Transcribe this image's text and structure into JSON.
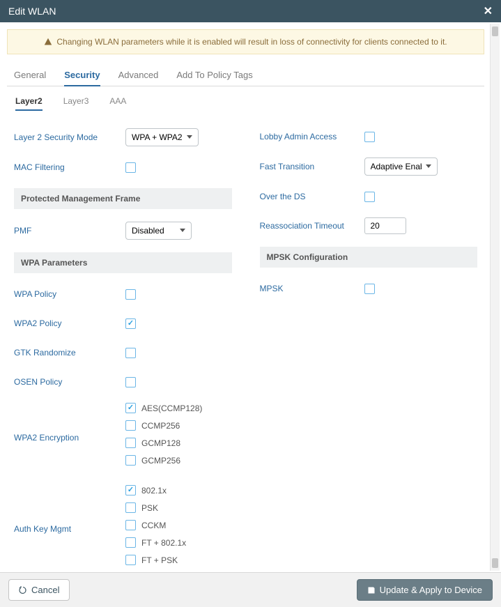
{
  "header": {
    "title": "Edit WLAN"
  },
  "alert": {
    "message": "Changing WLAN parameters while it is enabled will result in loss of connectivity for clients connected to it."
  },
  "tabs": {
    "items": [
      "General",
      "Security",
      "Advanced",
      "Add To Policy Tags"
    ],
    "active": 1
  },
  "subtabs": {
    "items": [
      "Layer2",
      "Layer3",
      "AAA"
    ],
    "active": 0
  },
  "left": {
    "l2mode": {
      "label": "Layer 2 Security Mode",
      "value": "WPA + WPA2"
    },
    "macfilter": {
      "label": "MAC Filtering",
      "checked": false
    },
    "pmf_section": "Protected Management Frame",
    "pmf": {
      "label": "PMF",
      "value": "Disabled"
    },
    "wpa_section": "WPA Parameters",
    "wpa_policy": {
      "label": "WPA Policy",
      "checked": false
    },
    "wpa2_policy": {
      "label": "WPA2 Policy",
      "checked": true
    },
    "gtk": {
      "label": "GTK Randomize",
      "checked": false
    },
    "osen": {
      "label": "OSEN Policy",
      "checked": false
    },
    "wpa2enc": {
      "label": "WPA2 Encryption",
      "options": [
        {
          "label": "AES(CCMP128)",
          "checked": true
        },
        {
          "label": "CCMP256",
          "checked": false
        },
        {
          "label": "GCMP128",
          "checked": false
        },
        {
          "label": "GCMP256",
          "checked": false
        }
      ]
    },
    "akm": {
      "label": "Auth Key Mgmt",
      "options": [
        {
          "label": "802.1x",
          "checked": true
        },
        {
          "label": "PSK",
          "checked": false
        },
        {
          "label": "CCKM",
          "checked": false
        },
        {
          "label": "FT + 802.1x",
          "checked": false
        },
        {
          "label": "FT + PSK",
          "checked": false
        }
      ]
    }
  },
  "right": {
    "lobby": {
      "label": "Lobby Admin Access",
      "checked": false
    },
    "ft": {
      "label": "Fast Transition",
      "value": "Adaptive Enab..."
    },
    "overds": {
      "label": "Over the DS",
      "checked": false
    },
    "reassoc": {
      "label": "Reassociation Timeout",
      "value": "20"
    },
    "mpsk_section": "MPSK Configuration",
    "mpsk": {
      "label": "MPSK",
      "checked": false
    }
  },
  "footer": {
    "cancel": "Cancel",
    "apply": "Update & Apply to Device"
  }
}
